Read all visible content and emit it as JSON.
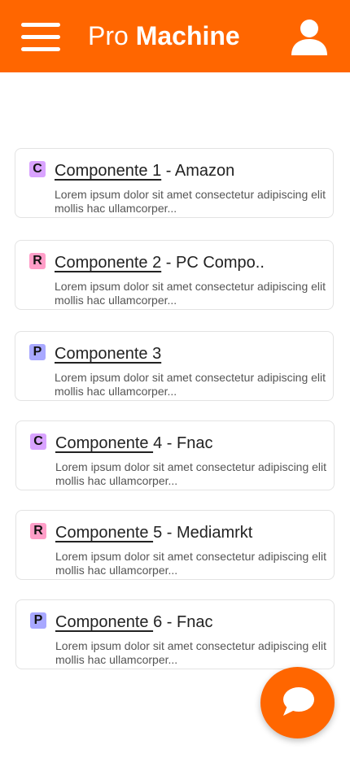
{
  "header": {
    "title_light": "Pro",
    "title_bold": "Machine",
    "menu_icon": "hamburger-menu-icon",
    "user_icon": "user-icon"
  },
  "colors": {
    "brand": "#FF6600"
  },
  "items": [
    {
      "badge": "C",
      "link": "Componente 1",
      "suffix": " - Amazon",
      "desc": "Lorem ipsum dolor sit amet consectetur adipiscing elit mollis hac ullamcorper..."
    },
    {
      "badge": "R",
      "link": "Componente 2",
      "suffix": " - PC Compo..",
      "desc": "Lorem ipsum dolor sit amet consectetur adipiscing elit mollis hac ullamcorper..."
    },
    {
      "badge": "P",
      "link": "Componente 3",
      "suffix": "",
      "desc": "Lorem ipsum dolor sit amet consectetur adipiscing elit mollis hac ullamcorper..."
    },
    {
      "badge": "C",
      "link": "Componente ",
      "suffix": "4 - Fnac",
      "desc": "Lorem ipsum dolor sit amet consectetur adipiscing elit mollis hac ullamcorper..."
    },
    {
      "badge": "R",
      "link": "Componente ",
      "suffix": "5 - Mediamrkt",
      "desc": "Lorem ipsum dolor sit amet consectetur adipiscing elit mollis hac ullamcorper..."
    },
    {
      "badge": "P",
      "link": "Componente ",
      "suffix": "6 - Fnac",
      "desc": "Lorem ipsum dolor sit amet consectetur adipiscing elit mollis hac ullamcorper..."
    }
  ],
  "fab": {
    "icon": "chat-bubble-icon"
  }
}
